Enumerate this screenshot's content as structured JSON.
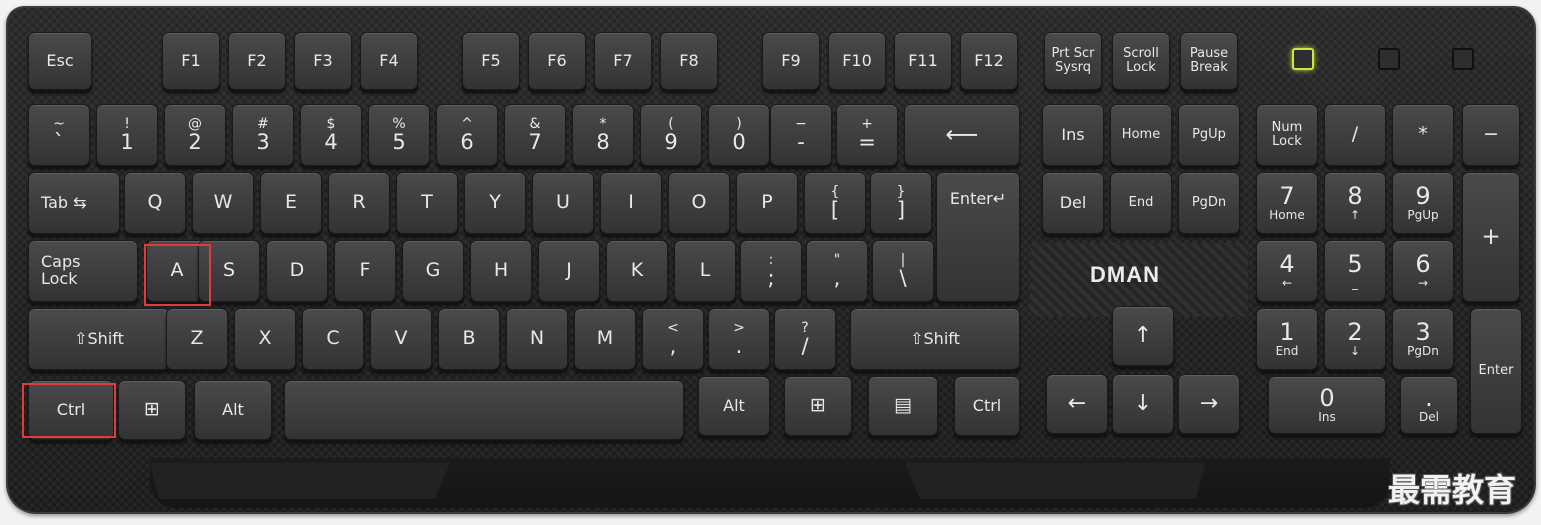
{
  "brand": "DMAN",
  "watermark": "最需教育",
  "highlight_color": "#e33a3a",
  "led_color": "#cfe63a",
  "row_function": {
    "esc": "Esc",
    "f1": "F1",
    "f2": "F2",
    "f3": "F3",
    "f4": "F4",
    "f5": "F5",
    "f6": "F6",
    "f7": "F7",
    "f8": "F8",
    "f9": "F9",
    "f10": "F10",
    "f11": "F11",
    "f12": "F12",
    "prtscr_1": "Prt Scr",
    "prtscr_2": "Sysrq",
    "scroll_1": "Scroll",
    "scroll_2": "Lock",
    "pause_1": "Pause",
    "pause_2": "Break"
  },
  "row_number": {
    "tilde_up": "~",
    "tilde_dn": "`",
    "k1_up": "!",
    "k1_dn": "1",
    "k2_up": "@",
    "k2_dn": "2",
    "k3_up": "#",
    "k3_dn": "3",
    "k4_up": "$",
    "k4_dn": "4",
    "k5_up": "%",
    "k5_dn": "5",
    "k6_up": "^",
    "k6_dn": "6",
    "k7_up": "&",
    "k7_dn": "7",
    "k8_up": "*",
    "k8_dn": "8",
    "k9_up": "(",
    "k9_dn": "9",
    "k0_up": ")",
    "k0_dn": "0",
    "minus_up": "−",
    "minus_dn": "-",
    "plus_up": "+",
    "plus_dn": "=",
    "backspace": "⟵"
  },
  "row_qwerty": {
    "tab": "Tab ⇆",
    "q": "Q",
    "w": "W",
    "e": "E",
    "r": "R",
    "t": "T",
    "y": "Y",
    "u": "U",
    "i": "I",
    "o": "O",
    "p": "P",
    "lbr_up": "{",
    "lbr_dn": "[",
    "rbr_up": "}",
    "rbr_dn": "]",
    "enter": "Enter↵"
  },
  "row_home": {
    "caps_1": "Caps",
    "caps_2": "Lock",
    "a": "A",
    "s": "S",
    "d": "D",
    "f": "F",
    "g": "G",
    "h": "H",
    "j": "J",
    "k": "K",
    "l": "L",
    "semi_up": ":",
    "semi_dn": ";",
    "quote_up": "\"",
    "quote_dn": ",",
    "bslash_up": "|",
    "bslash_dn": "\\"
  },
  "row_shift": {
    "lshift": "⇧Shift",
    "z": "Z",
    "x": "X",
    "c": "C",
    "v": "V",
    "b": "B",
    "n": "N",
    "m": "M",
    "comma_up": "<",
    "comma_dn": ",",
    "period_up": ">",
    "period_dn": ".",
    "slash_up": "?",
    "slash_dn": "/",
    "rshift": "⇧Shift"
  },
  "row_bottom": {
    "lctrl": "Ctrl",
    "lwin": "⊞",
    "lalt": "Alt",
    "ralt": "Alt",
    "rwin": "⊞",
    "menu": "▤",
    "rctrl": "Ctrl"
  },
  "nav": {
    "ins": "Ins",
    "home": "Home",
    "pgup": "PgUp",
    "del": "Del",
    "end": "End",
    "pgdn": "PgDn",
    "up": "↑",
    "left": "←",
    "down": "↓",
    "right": "→"
  },
  "numpad": {
    "numlock_1": "Num",
    "numlock_2": "Lock",
    "div": "/",
    "mul": "*",
    "sub": "−",
    "add": "+",
    "enter": "Enter",
    "n7": "7",
    "n7s": "Home",
    "n8": "8",
    "n8s": "↑",
    "n9": "9",
    "n9s": "PgUp",
    "n4": "4",
    "n4s": "←",
    "n5": "5",
    "n5s": "_",
    "n6": "6",
    "n6s": "→",
    "n1": "1",
    "n1s": "End",
    "n2": "2",
    "n2s": "↓",
    "n3": "3",
    "n3s": "PgDn",
    "n0": "0",
    "n0s": "Ins",
    "dot": ".",
    "dots": "Del"
  },
  "leds": [
    "num-lock",
    "caps-lock",
    "scroll-lock"
  ]
}
